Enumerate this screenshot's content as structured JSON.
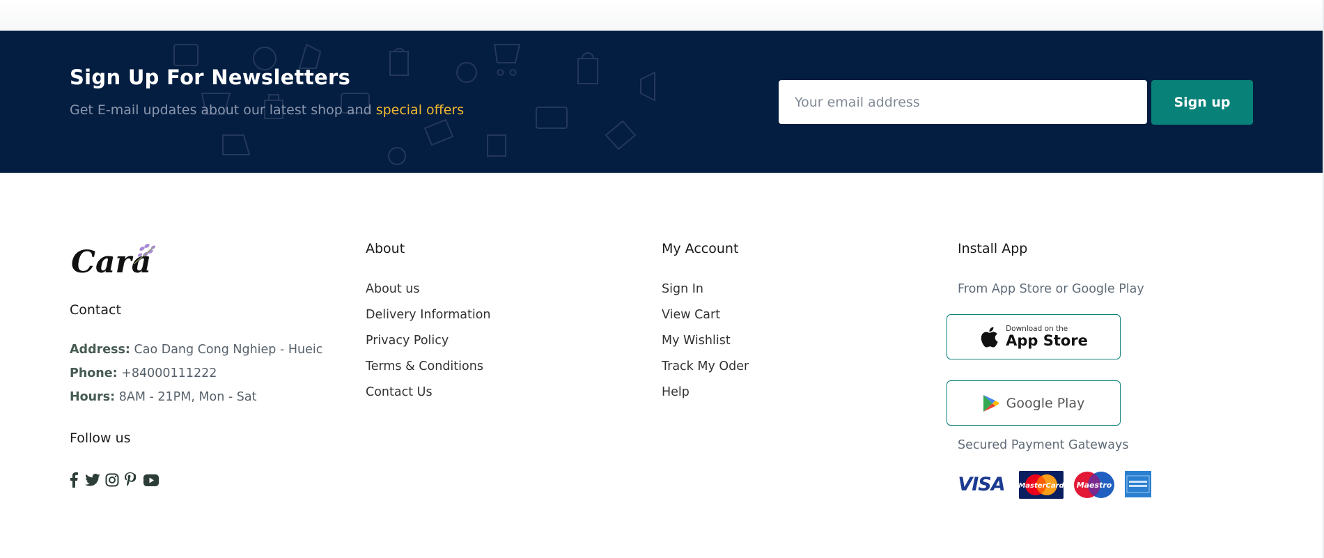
{
  "newsletter": {
    "title": "Sign Up For Newsletters",
    "subtitle_prefix": "Get E-mail updates about our latest shop and",
    "subtitle_highlight": "special offers",
    "email_placeholder": "Your email address",
    "signup_label": "Sign up"
  },
  "footer": {
    "logo_text": "Cara",
    "contact": {
      "heading": "Contact",
      "address_label": "Address:",
      "address_value": "Cao Dang Cong Nghiep - Hueic",
      "phone_label": "Phone:",
      "phone_value": "+84000111222",
      "hours_label": "Hours:",
      "hours_value": "8AM - 21PM, Mon - Sat",
      "follow_heading": "Follow us",
      "social_icons": [
        "facebook-icon",
        "twitter-icon",
        "instagram-icon",
        "pinterest-icon",
        "youtube-icon"
      ]
    },
    "about": {
      "heading": "About",
      "links": [
        "About us",
        "Delivery Information",
        "Privacy Policy",
        "Terms & Conditions",
        "Contact Us"
      ]
    },
    "account": {
      "heading": "My Account",
      "links": [
        "Sign In",
        "View Cart",
        "My Wishlist",
        "Track My Oder",
        "Help"
      ]
    },
    "install": {
      "heading": "Install App",
      "subtitle": "From App Store or Google Play",
      "app_store_small": "Download on the",
      "app_store_big": "App Store",
      "google_play": "Google Play",
      "payment_heading": "Secured Payment Gateways",
      "payments": [
        "VISA",
        "MasterCard",
        "Maestro",
        "American Express"
      ]
    }
  },
  "colors": {
    "newsletter_bg": "#041e42",
    "accent": "#088178",
    "highlight": "#f1b92d"
  }
}
